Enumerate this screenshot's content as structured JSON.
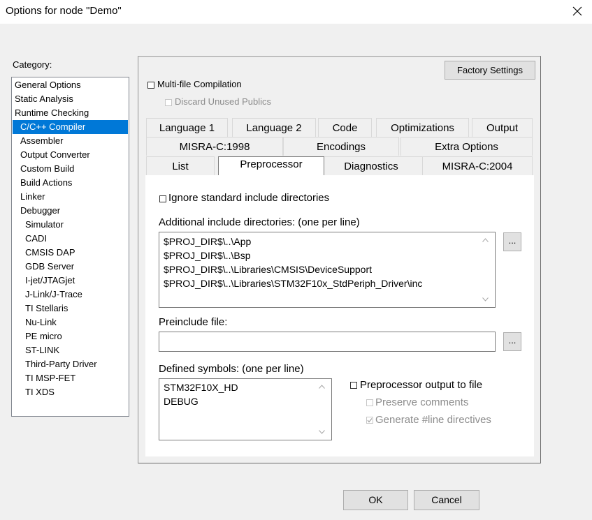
{
  "window": {
    "title": "Options for node \"Demo\""
  },
  "category": {
    "label": "Category:",
    "items": [
      {
        "label": "General Options",
        "indent": 0
      },
      {
        "label": "Static Analysis",
        "indent": 0
      },
      {
        "label": "Runtime Checking",
        "indent": 0
      },
      {
        "label": "C/C++ Compiler",
        "indent": 1,
        "selected": true
      },
      {
        "label": "Assembler",
        "indent": 1
      },
      {
        "label": "Output Converter",
        "indent": 1
      },
      {
        "label": "Custom Build",
        "indent": 1
      },
      {
        "label": "Build Actions",
        "indent": 1
      },
      {
        "label": "Linker",
        "indent": 1
      },
      {
        "label": "Debugger",
        "indent": 1
      },
      {
        "label": "Simulator",
        "indent": 2
      },
      {
        "label": "CADI",
        "indent": 2
      },
      {
        "label": "CMSIS DAP",
        "indent": 2
      },
      {
        "label": "GDB Server",
        "indent": 2
      },
      {
        "label": "I-jet/JTAGjet",
        "indent": 2
      },
      {
        "label": "J-Link/J-Trace",
        "indent": 2
      },
      {
        "label": "TI Stellaris",
        "indent": 2
      },
      {
        "label": "Nu-Link",
        "indent": 2
      },
      {
        "label": "PE micro",
        "indent": 2
      },
      {
        "label": "ST-LINK",
        "indent": 2
      },
      {
        "label": "Third-Party Driver",
        "indent": 2
      },
      {
        "label": "TI MSP-FET",
        "indent": 2
      },
      {
        "label": "TI XDS",
        "indent": 2
      }
    ]
  },
  "factory_settings_label": "Factory Settings",
  "multifile": {
    "label": "Multi-file Compilation",
    "checked": false
  },
  "discard": {
    "label": "Discard Unused Publics",
    "checked": false,
    "disabled": true
  },
  "tabs": {
    "row1": [
      "Language 1",
      "Language 2",
      "Code",
      "Optimizations",
      "Output"
    ],
    "row2": [
      "MISRA-C:1998",
      "Encodings",
      "Extra Options"
    ],
    "row3": [
      "List",
      "Preprocessor",
      "Diagnostics",
      "MISRA-C:2004"
    ],
    "selected": "Preprocessor"
  },
  "preprocessor": {
    "ignore_std": {
      "label": "Ignore standard include directories",
      "checked": false
    },
    "include_dirs": {
      "label": "Additional include directories: (one per line)",
      "lines": [
        "$PROJ_DIR$\\..\\App",
        "$PROJ_DIR$\\..\\Bsp",
        "$PROJ_DIR$\\..\\Libraries\\CMSIS\\DeviceSupport",
        "$PROJ_DIR$\\..\\Libraries\\STM32F10x_StdPeriph_Driver\\inc"
      ]
    },
    "browse_label": "...",
    "preinclude": {
      "label": "Preinclude file:",
      "value": ""
    },
    "defined_symbols": {
      "label": "Defined symbols: (one per line)",
      "lines": [
        "STM32F10X_HD",
        "DEBUG"
      ]
    },
    "output_to_file": {
      "label": "Preprocessor output to file",
      "checked": false
    },
    "preserve_comments": {
      "label": "Preserve comments",
      "checked": false,
      "disabled": true
    },
    "generate_line": {
      "label": "Generate #line directives",
      "checked": true,
      "disabled": true
    }
  },
  "buttons": {
    "ok": "OK",
    "cancel": "Cancel"
  },
  "colors": {
    "selection": "#0078d7",
    "dialog_bg": "#f0f0f0",
    "button_bg": "#e1e1e1"
  }
}
